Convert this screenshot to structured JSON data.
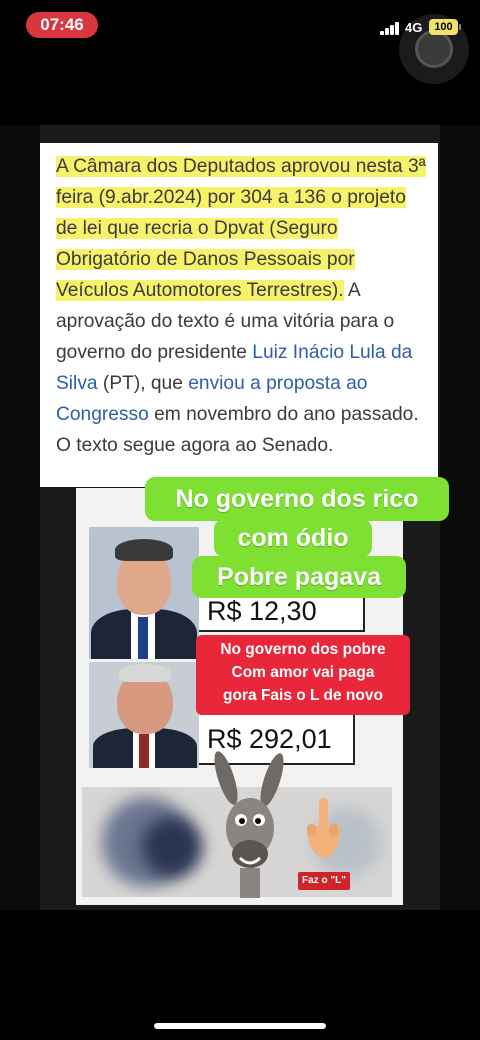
{
  "status_bar": {
    "time": "07:46",
    "network": "4G",
    "battery": "100",
    "accent": "#d9363e"
  },
  "article": {
    "highlighted": "A Câmara dos Deputados aprovou nesta 3ª feira (9.abr.2024) por 304 a 136 o projeto de lei que recria o Dpvat (Seguro Obrigatório de Danos Pessoais por Veículos Automotores Terrestres).",
    "text_a": " A aprovação do texto é uma vitória para o governo do presidente ",
    "link_1": "Luiz Inácio Lula da Silva",
    "text_b": " (PT), que ",
    "link_2": "enviou a proposta ao Congresso",
    "text_c": " em novembro do ano passado. O texto segue agora ao Senado.",
    "highlight_color": "#f6f26a",
    "link_color": "#2f5ea8"
  },
  "meme": {
    "price_1": "R$ 12,30",
    "price_2": "R$ 292,01",
    "badge": "Faz o \"L\"",
    "green_caption": [
      "No governo dos rico",
      "com ódio",
      "Pobre pagava"
    ],
    "red_caption": [
      "No governo dos pobre",
      "Com amor vai paga",
      "gora  Fais o L de novo"
    ],
    "green_color": "#7ee033",
    "red_color": "#e8283a"
  }
}
